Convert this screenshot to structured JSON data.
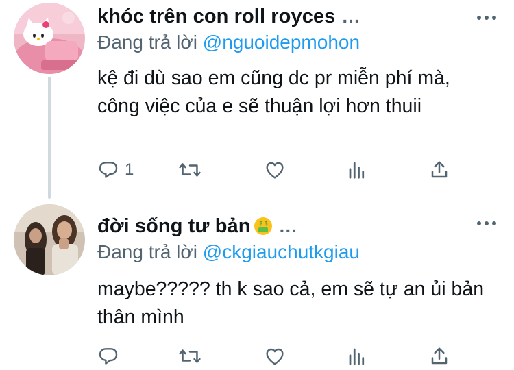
{
  "tweets": [
    {
      "display_name": "khóc trên con roll royces",
      "name_overflow": "...",
      "reply_prefix": "Đang trả lời",
      "reply_handle": "@nguoidepmohon",
      "text": "kệ đi dù sao em cũng dc pr miễn phí mà, công việc của e sẽ thuận lợi hơn thuii",
      "reply_count": "1",
      "avatar_icon": "hello-kitty-avatar"
    },
    {
      "display_name": "đời sống tư bản",
      "name_overflow": "...",
      "emoji_icon": "money-mouth-emoji",
      "reply_prefix": "Đang trả lời",
      "reply_handle": "@ckgiauchutkgiau",
      "text": "maybe????? th k sao cả, em sẽ tự an ủi bản thân mình",
      "reply_count": "",
      "avatar_icon": "photo-avatar"
    }
  ],
  "colors": {
    "text": "#0f1419",
    "secondary": "#536471",
    "link": "#1d9bf0",
    "thread_line": "#cfd9de"
  }
}
